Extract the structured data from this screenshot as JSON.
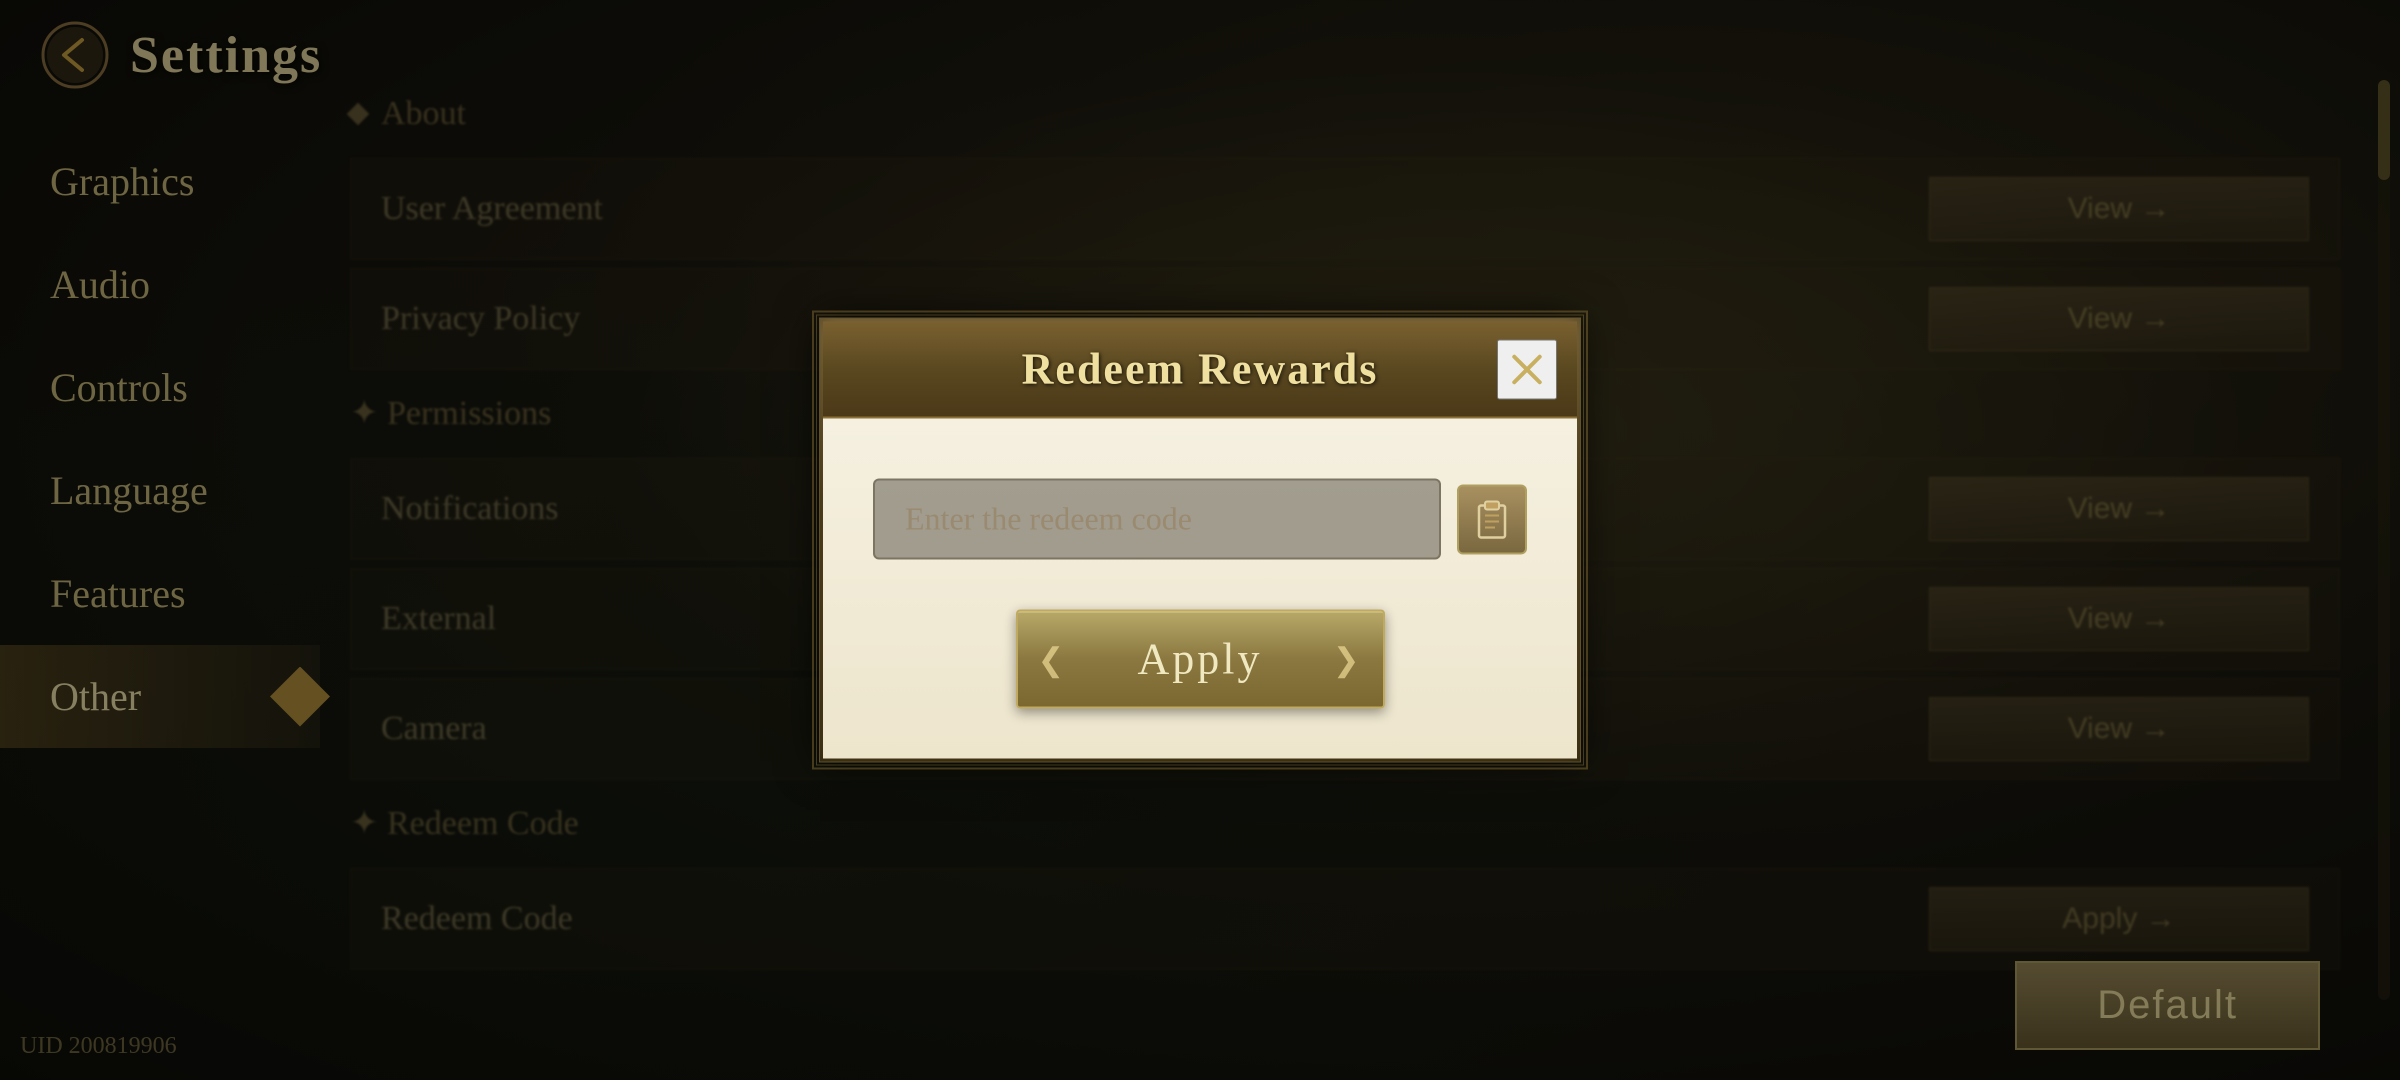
{
  "header": {
    "title": "Settings",
    "icon_label": "settings-back-icon"
  },
  "sidebar": {
    "items": [
      {
        "id": "graphics",
        "label": "Graphics",
        "active": false
      },
      {
        "id": "audio",
        "label": "Audio",
        "active": false
      },
      {
        "id": "controls",
        "label": "Controls",
        "active": false
      },
      {
        "id": "language",
        "label": "Language",
        "active": false
      },
      {
        "id": "features",
        "label": "Features",
        "active": false
      },
      {
        "id": "other",
        "label": "Other",
        "active": true
      }
    ]
  },
  "main": {
    "section_about": "About",
    "rows": [
      {
        "id": "user-agreement",
        "label": "User Agreement",
        "has_help": true,
        "action": "View →"
      },
      {
        "id": "privacy-policy",
        "label": "Privacy Policy",
        "has_help": false,
        "action": "View →"
      },
      {
        "id": "notifications",
        "label": "Notifications",
        "has_help": false,
        "action": "View →"
      },
      {
        "id": "external",
        "label": "External",
        "has_help": false,
        "action": "View →"
      },
      {
        "id": "camera",
        "label": "Camera",
        "has_help": false,
        "action": "View →"
      },
      {
        "id": "redeem-code-sub",
        "label": "✦ Redeem Code",
        "has_help": false,
        "action": ""
      },
      {
        "id": "redeem-code",
        "label": "Redeem Code",
        "has_help": false,
        "action": "Apply →"
      }
    ],
    "section_permissions": "✦ Permissions"
  },
  "default_button": {
    "label": "Default"
  },
  "uid": {
    "label": "UID 200819906"
  },
  "modal": {
    "title": "Redeem Rewards",
    "close_label": "✕",
    "input_placeholder": "Enter the redeem code",
    "apply_label": "Apply",
    "paste_icon": "paste-icon"
  }
}
